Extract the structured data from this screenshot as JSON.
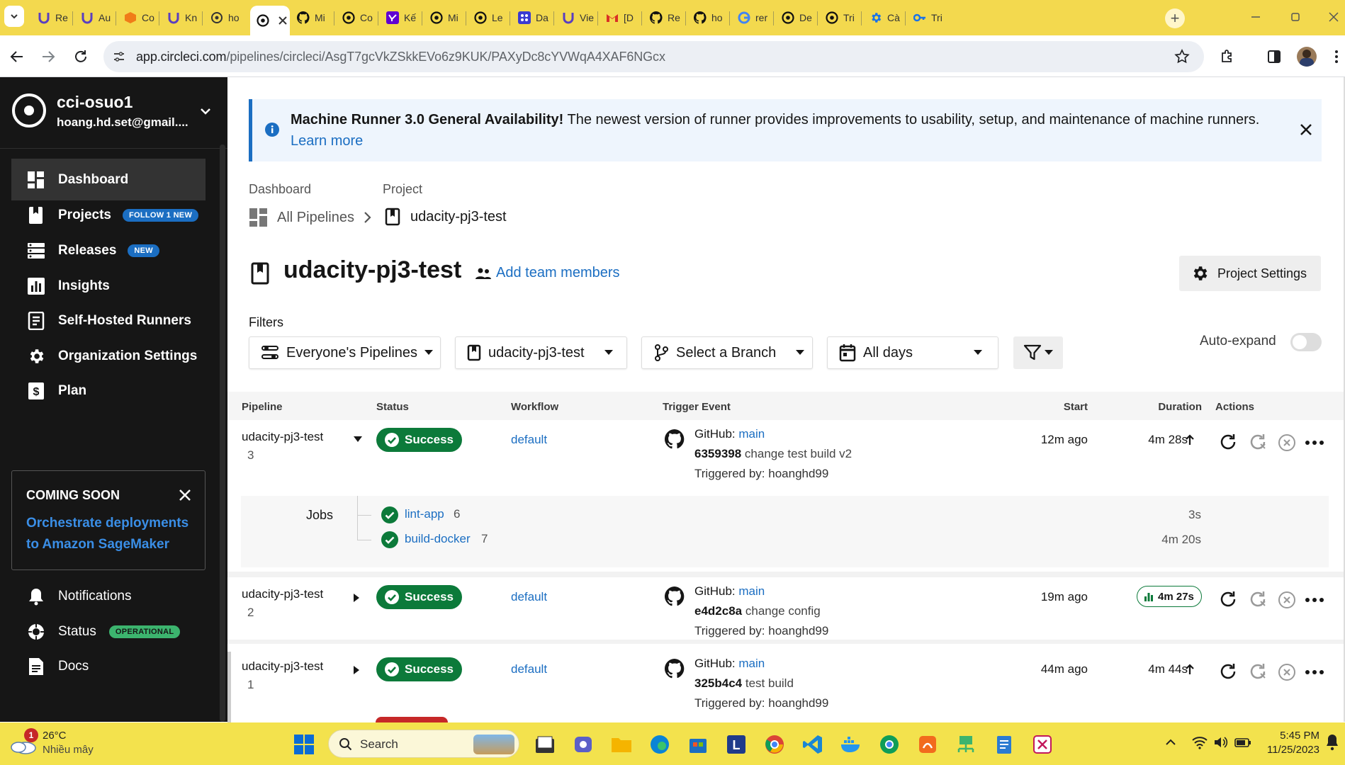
{
  "browser": {
    "tabs": [
      {
        "title": "Re",
        "icon": "u-icon"
      },
      {
        "title": "Au",
        "icon": "u-icon"
      },
      {
        "title": "Co",
        "icon": "box-icon"
      },
      {
        "title": "Kn",
        "icon": "u-icon"
      },
      {
        "title": "ho",
        "icon": "openai-icon"
      },
      {
        "title": "",
        "icon": "circleci-icon",
        "active": true
      },
      {
        "title": "Mi",
        "icon": "github-icon"
      },
      {
        "title": "Co",
        "icon": "circleci-icon"
      },
      {
        "title": "Kế",
        "icon": "yahoo-icon"
      },
      {
        "title": "Mi",
        "icon": "circleci-icon"
      },
      {
        "title": "Le",
        "icon": "circleci-icon"
      },
      {
        "title": "Da",
        "icon": "grid-icon"
      },
      {
        "title": "Vie",
        "icon": "u-icon"
      },
      {
        "title": "[D",
        "icon": "gmail-icon"
      },
      {
        "title": "Re",
        "icon": "github-icon"
      },
      {
        "title": "ho",
        "icon": "github-icon"
      },
      {
        "title": "rer",
        "icon": "google-icon"
      },
      {
        "title": "De",
        "icon": "circleci-icon"
      },
      {
        "title": "Tri",
        "icon": "circleci-icon"
      },
      {
        "title": "Cà",
        "icon": "gear-icon"
      },
      {
        "title": "Tri",
        "icon": "key-icon"
      }
    ],
    "url_host": "app.circleci.com",
    "url_path": "/pipelines/circleci/AsgT7gcVkZSkkEVo6z9KUK/PAXyDc8cYVWqA4XAF6NGcx"
  },
  "sidebar": {
    "org_name": "cci-osuo1",
    "org_email": "hoang.hd.set@gmail....",
    "items": [
      {
        "label": "Dashboard",
        "badge": "",
        "icon": "dashboard-icon",
        "active": true
      },
      {
        "label": "Projects",
        "badge": "FOLLOW 1 NEW",
        "icon": "bookmark-icon"
      },
      {
        "label": "Releases",
        "badge": "NEW",
        "icon": "releases-icon"
      },
      {
        "label": "Insights",
        "badge": "",
        "icon": "insights-icon"
      },
      {
        "label": "Self-Hosted Runners",
        "badge": "",
        "icon": "runner-icon"
      },
      {
        "label": "Organization Settings",
        "badge": "",
        "icon": "gear-icon"
      },
      {
        "label": "Plan",
        "badge": "",
        "icon": "dollar-icon"
      }
    ],
    "promo": {
      "heading": "COMING SOON",
      "line1": "Orchestrate deployments",
      "line2": "to Amazon SageMaker"
    },
    "footer": [
      {
        "label": "Notifications",
        "badge": "",
        "icon": "bell-icon"
      },
      {
        "label": "Status",
        "badge": "OPERATIONAL",
        "icon": "status-icon"
      },
      {
        "label": "Docs",
        "badge": "",
        "icon": "docs-icon"
      }
    ]
  },
  "banner": {
    "bold": "Machine Runner 3.0 General Availability!",
    "text": "The newest version of runner provides improvements to usability, setup, and maintenance of machine runners.",
    "link": "Learn more"
  },
  "breadcrumb": {
    "label1": "Dashboard",
    "value1": "All Pipelines",
    "label2": "Project",
    "value2": "udacity-pj3-test"
  },
  "project": {
    "title": "udacity-pj3-test",
    "add_team": "Add team members",
    "settings": "Project Settings"
  },
  "filters": {
    "label": "Filters",
    "pipelines": "Everyone's Pipelines",
    "project": "udacity-pj3-test",
    "branch": "Select a Branch",
    "days": "All days",
    "auto_expand": "Auto-expand"
  },
  "table": {
    "headers": [
      "Pipeline",
      "Status",
      "Workflow",
      "Trigger Event",
      "Start",
      "Duration",
      "Actions"
    ],
    "rows": [
      {
        "name": "udacity-pj3-test",
        "number": "3",
        "status": "Success",
        "workflow": "default",
        "source": "GitHub:",
        "branch": "main",
        "sha": "6359398",
        "message": "change test build v2",
        "triggered": "Triggered by: hoanghd99",
        "start": "12m ago",
        "duration": "4m 28s"
      },
      {
        "name": "udacity-pj3-test",
        "number": "2",
        "status": "Success",
        "workflow": "default",
        "source": "GitHub:",
        "branch": "main",
        "sha": "e4d2c8a",
        "message": "change config",
        "triggered": "Triggered by: hoanghd99",
        "start": "19m ago",
        "duration": "4m 27s"
      },
      {
        "name": "udacity-pj3-test",
        "number": "1",
        "status": "Success",
        "workflow": "default",
        "source": "GitHub:",
        "branch": "main",
        "sha": "325b4c4",
        "message": "test build",
        "triggered": "Triggered by: hoanghd99",
        "start": "44m ago",
        "duration": "4m 44s"
      }
    ],
    "jobs_label": "Jobs",
    "jobs": [
      {
        "name": "lint-app",
        "number": "6",
        "duration": "3s"
      },
      {
        "name": "build-docker",
        "number": "7",
        "duration": "4m 20s"
      }
    ]
  },
  "taskbar": {
    "weather_temp": "26°C",
    "weather_text": "Nhiều mây",
    "weather_badge": "1",
    "search": "Search",
    "time": "5:45 PM",
    "date": "11/25/2023"
  },
  "colors": {
    "tabbar": "#f3d94e",
    "sidebar": "#161616",
    "success": "#0c7a3a",
    "link": "#1b6ec2",
    "taskbar": "#f3e24d"
  }
}
